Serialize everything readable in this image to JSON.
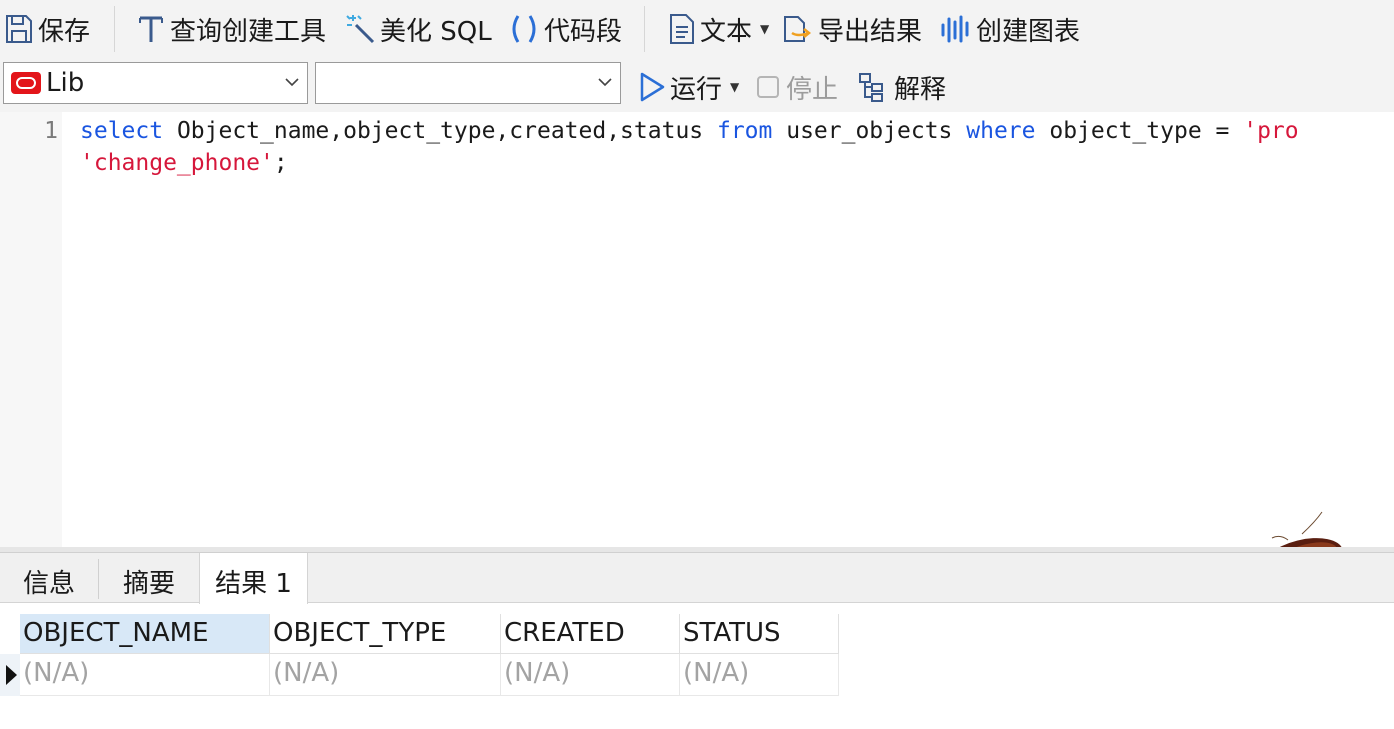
{
  "toolbar": {
    "save": "保存",
    "query_builder": "查询创建工具",
    "beautify_sql": "美化 SQL",
    "code_snippet": "代码段",
    "text": "文本",
    "export_result": "导出结果",
    "create_chart": "创建图表"
  },
  "connection": {
    "selected": "Lib",
    "schema_selected": ""
  },
  "run_bar": {
    "run": "运行",
    "stop": "停止",
    "explain": "解释"
  },
  "editor": {
    "line_number": "1",
    "line1": {
      "t1": "select",
      "t2": " Object_name,object_type,created,status ",
      "t3": "from",
      "t4": " user_objects ",
      "t5": "where",
      "t6": " object_type = ",
      "t7": "'pro"
    },
    "line2": {
      "t1": "'change_phone'",
      "t2": ";"
    }
  },
  "result_tabs": [
    "信息",
    "摘要",
    "结果 1"
  ],
  "result_grid": {
    "columns": [
      "OBJECT_NAME",
      "OBJECT_TYPE",
      "CREATED",
      "STATUS"
    ],
    "rows": [
      [
        "(N/A)",
        "(N/A)",
        "(N/A)",
        "(N/A)"
      ]
    ]
  },
  "colors": {
    "keyword": "#1a55e0",
    "string": "#d6173b",
    "toolbar_bg": "#f3f3f3",
    "selected_header": "#d8e8f7",
    "oracle_red": "#e3151a"
  }
}
